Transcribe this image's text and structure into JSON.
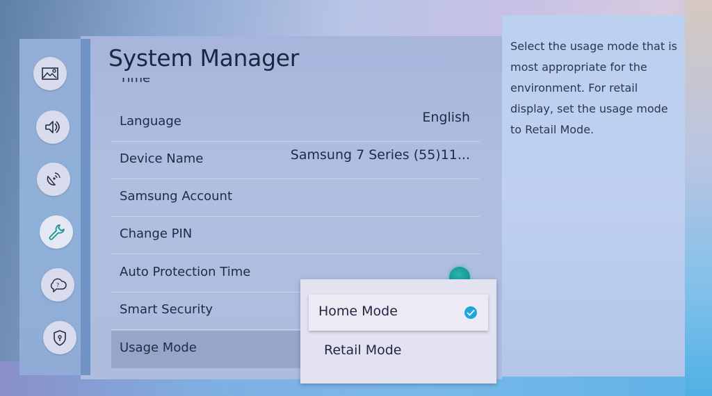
{
  "header": {
    "title": "System Manager"
  },
  "sidebar": {
    "items": [
      {
        "icon": "picture-icon",
        "label": "Picture",
        "active": false
      },
      {
        "icon": "sound-icon",
        "label": "Sound",
        "active": false
      },
      {
        "icon": "broadcasting-icon",
        "label": "Broadcasting",
        "active": false
      },
      {
        "icon": "wrench-icon",
        "label": "General",
        "active": true
      },
      {
        "icon": "support-icon",
        "label": "Support",
        "active": false
      },
      {
        "icon": "privacy-shield-icon",
        "label": "Privacy",
        "active": false
      }
    ]
  },
  "settings": {
    "partial_item": "Time",
    "rows": [
      {
        "label": "Language",
        "value": "English"
      },
      {
        "label": "Device Name",
        "value": "Samsung 7 Series (55)11..."
      },
      {
        "label": "Samsung Account",
        "value": ""
      },
      {
        "label": "Change PIN",
        "value": ""
      },
      {
        "label": "Auto Protection Time",
        "value": ""
      },
      {
        "label": "Smart Security",
        "value": ""
      },
      {
        "label": "Usage Mode",
        "value": ""
      }
    ]
  },
  "usage_mode_popup": {
    "options": [
      {
        "label": "Home Mode",
        "selected": true
      },
      {
        "label": "Retail Mode",
        "selected": false
      }
    ]
  },
  "description": {
    "text": "Select the usage mode that is most appropriate for the environment. For retail display, set the usage mode to Retail Mode."
  },
  "colors": {
    "accent": "#1fa6de",
    "focus_ring": "#189a99"
  }
}
